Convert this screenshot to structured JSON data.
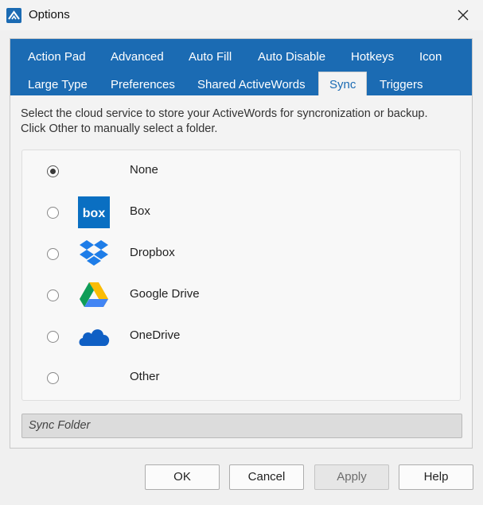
{
  "window": {
    "title": "Options",
    "close_icon": "close-icon"
  },
  "tabs": {
    "row1": [
      "Action Pad",
      "Advanced",
      "Auto Fill",
      "Auto Disable",
      "Hotkeys",
      "Icon"
    ],
    "row2": [
      "Large Type",
      "Preferences",
      "Shared ActiveWords",
      "Sync",
      "Triggers"
    ],
    "active": "Sync"
  },
  "sync": {
    "description_line1": "Select the cloud service to store your ActiveWords for syncronization or backup.",
    "description_line2": "Click Other to manually select a folder.",
    "options": [
      {
        "label": "None",
        "checked": true,
        "icon": ""
      },
      {
        "label": "Box",
        "checked": false,
        "icon": "box-logo-icon",
        "logo_text": "box"
      },
      {
        "label": "Dropbox",
        "checked": false,
        "icon": "dropbox-icon"
      },
      {
        "label": "Google Drive",
        "checked": false,
        "icon": "google-drive-icon"
      },
      {
        "label": "OneDrive",
        "checked": false,
        "icon": "onedrive-icon"
      },
      {
        "label": "Other",
        "checked": false,
        "icon": ""
      }
    ],
    "folder_placeholder": "Sync Folder"
  },
  "buttons": {
    "ok": "OK",
    "cancel": "Cancel",
    "apply": "Apply",
    "help": "Help"
  },
  "colors": {
    "accent": "#1b6bb3",
    "box_blue": "#0a6fc2",
    "dropbox_blue": "#1e7de8",
    "onedrive_blue": "#0f5fc4"
  }
}
